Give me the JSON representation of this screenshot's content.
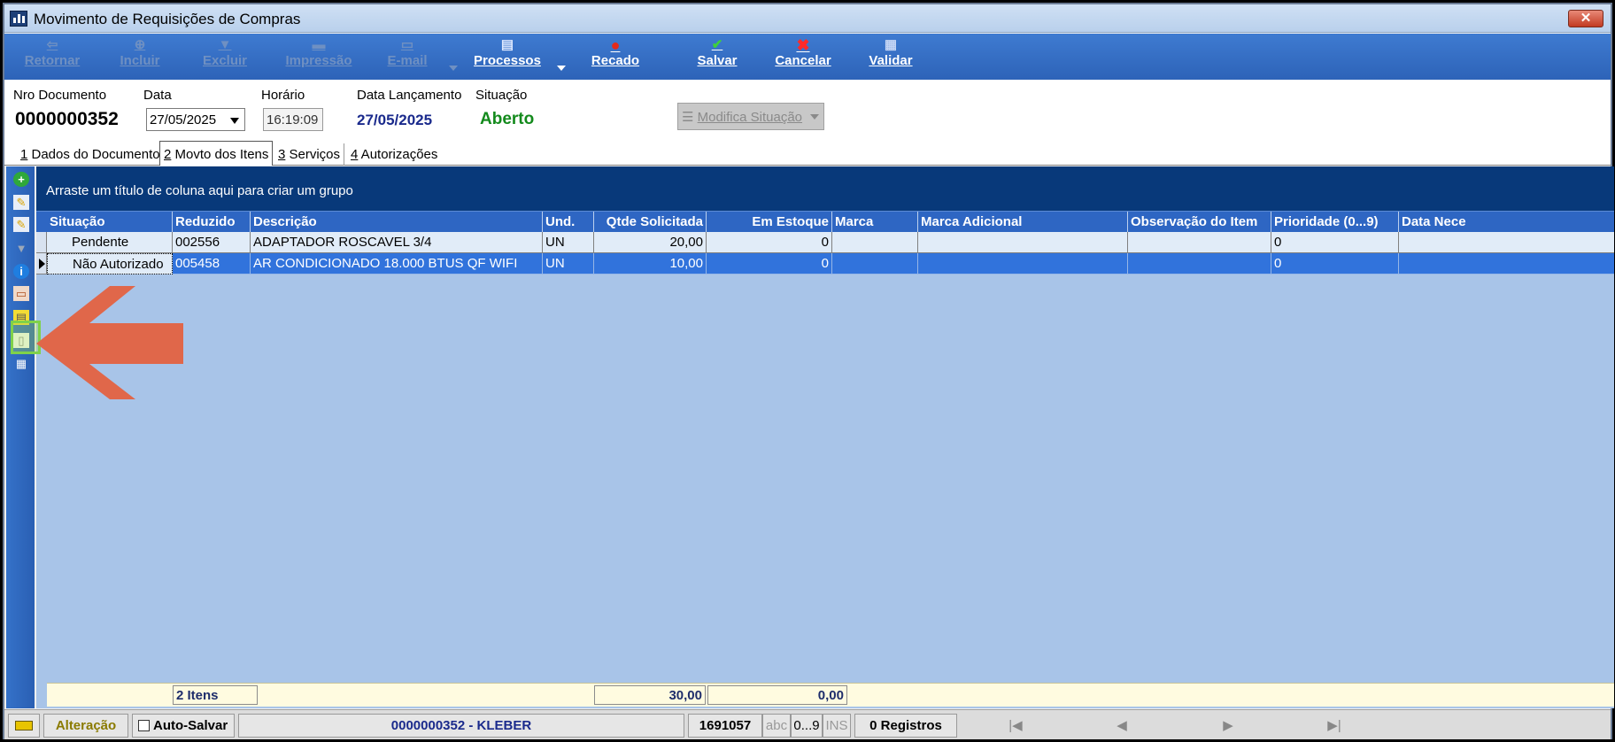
{
  "window": {
    "title": "Movimento de Requisições de Compras",
    "close_label": "✕"
  },
  "toolbar": {
    "buttons": [
      {
        "label": "Retornar",
        "icon": "back-icon",
        "enabled": false
      },
      {
        "label": "Incluir",
        "icon": "add-icon",
        "enabled": false
      },
      {
        "label": "Excluir",
        "icon": "delete-icon",
        "enabled": false
      },
      {
        "label": "Impressão",
        "icon": "print-icon",
        "enabled": false
      },
      {
        "label": "E-mail",
        "icon": "email-icon",
        "enabled": false
      },
      {
        "label": "Processos",
        "icon": "process-icon",
        "enabled": true
      },
      {
        "label": "Recado",
        "icon": "speech-bubble-icon",
        "enabled": true
      },
      {
        "label": "Salvar",
        "icon": "check-icon",
        "enabled": true
      },
      {
        "label": "Cancelar",
        "icon": "x-icon",
        "enabled": true
      },
      {
        "label": "Validar",
        "icon": "validate-icon",
        "enabled": true
      }
    ]
  },
  "header": {
    "nro_label": "Nro Documento",
    "nro_value": "0000000352",
    "data_label": "Data",
    "data_value": "27/05/2025",
    "horario_label": "Horário",
    "horario_value": "16:19:09",
    "lanc_label": "Data Lançamento",
    "lanc_value": "27/05/2025",
    "situacao_label": "Situação",
    "situacao_value": "Aberto",
    "modifica_label": "Modifica Situação",
    "colors": {
      "lanc": "#1a2a8c",
      "situacao": "#138a1c"
    }
  },
  "tabs": [
    {
      "key": "1",
      "label": " Dados do Documento"
    },
    {
      "key": "2",
      "label": " Movto dos Itens"
    },
    {
      "key": "3",
      "label": " Serviços"
    },
    {
      "key": "4",
      "label": " Autorizações"
    }
  ],
  "grid": {
    "group_hint": "Arraste um título de coluna aqui para criar um grupo",
    "columns": [
      "Situação",
      "Reduzido",
      "Descrição",
      "Und.",
      "Qtde Solicitada",
      "Em Estoque",
      "Marca",
      "Marca Adicional",
      "Observação do Item",
      "Prioridade (0...9)",
      "Data Nece"
    ],
    "rows": [
      [
        "Pendente",
        "002556",
        "ADAPTADOR ROSCAVEL 3/4",
        "UN",
        "20,00",
        "0",
        "",
        "",
        "",
        "0",
        ""
      ],
      [
        "Não Autorizado",
        "005458",
        "AR CONDICIONADO 18.000 BTUS QF WIFI",
        "UN",
        "10,00",
        "0",
        "",
        "",
        "",
        "0",
        ""
      ]
    ],
    "footer": {
      "itens": "2 Itens",
      "qtde_total": "30,00",
      "estoque_total": "0,00"
    },
    "selected_color": "#3173dc"
  },
  "statusbar": {
    "mode": "Alteração",
    "autosave": "Auto-Salvar",
    "document": "0000000352 - KLEBER",
    "code": "1691057",
    "abc": "abc",
    "num": "0...9",
    "ins": "INS",
    "registros": "0 Registros",
    "nav": [
      "|◀",
      "◀",
      "▶",
      "▶|"
    ]
  },
  "annotation": {
    "arrow_color": "#e0674a",
    "highlight_color": "#7fd14a"
  }
}
